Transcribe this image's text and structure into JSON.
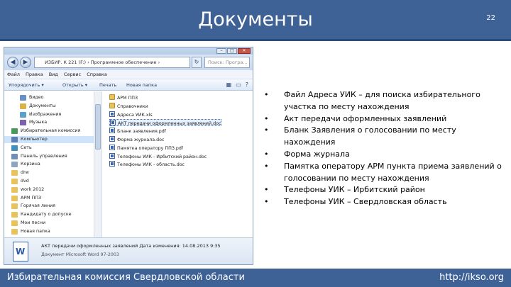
{
  "slide": {
    "title": "Документы",
    "number": "22",
    "footer_left": "Избирательная комиссия Свердловской области",
    "footer_right": "http://ikso.org",
    "header_color": "#3f6296"
  },
  "explorer": {
    "address": "ИЗБИР. К 221 (F:) › Программное обеспечение ›",
    "search_placeholder": "Поиск: Програ...",
    "menu": [
      "Файл",
      "Правка",
      "Вид",
      "Сервис",
      "Справка"
    ],
    "toolbar": {
      "organize": "Упорядочить ▾",
      "open": "Открыть ▾",
      "print": "Печать",
      "new_folder": "Новая папка"
    },
    "nav_items": [
      {
        "label": "Видео",
        "icon": "video-icon"
      },
      {
        "label": "Документы",
        "icon": "documents-icon"
      },
      {
        "label": "Изображения",
        "icon": "pictures-icon"
      },
      {
        "label": "Музыка",
        "icon": "music-icon"
      },
      {
        "label": "Избирательная комиссия",
        "icon": "homegroup-icon"
      },
      {
        "label": "Компьютер",
        "icon": "computer-icon",
        "selected": true
      },
      {
        "label": "Сеть",
        "icon": "network-icon"
      },
      {
        "label": "Панель управления",
        "icon": "control-panel-icon"
      },
      {
        "label": "Корзина",
        "icon": "recycle-bin-icon"
      },
      {
        "label": "drw",
        "icon": "folder-icon"
      },
      {
        "label": "dvd",
        "icon": "folder-icon"
      },
      {
        "label": "work 2012",
        "icon": "folder-icon"
      },
      {
        "label": "АРМ ППЗ",
        "icon": "folder-icon"
      },
      {
        "label": "Горячая линия",
        "icon": "folder-icon"
      },
      {
        "label": "Кандидату о допуске",
        "icon": "folder-icon"
      },
      {
        "label": "Мои песни",
        "icon": "folder-icon"
      },
      {
        "label": "Новая папка",
        "icon": "folder-icon"
      }
    ],
    "files": [
      {
        "label": "АРМ ППЗ",
        "kind": "folder"
      },
      {
        "label": "Справочники",
        "kind": "folder"
      },
      {
        "label": "Адреса УИК.xls",
        "kind": "doc"
      },
      {
        "label": "АКТ передачи оформленных заявлений.doc",
        "kind": "doc",
        "selected": true
      },
      {
        "label": "Бланк заявления.pdf",
        "kind": "doc"
      },
      {
        "label": "Форма журнала.doc",
        "kind": "doc"
      },
      {
        "label": "Памятка оператору ППЗ.pdf",
        "kind": "doc"
      },
      {
        "label": "Телефоны УИК - Ирбитский район.doc",
        "kind": "doc"
      },
      {
        "label": "Телефоны УИК - область.doc",
        "kind": "doc"
      }
    ],
    "details": {
      "name": "АКТ передачи оформленных заявлений   Дата изменения: 14.08.2013 9:35",
      "type": "Документ Microsoft Word 97-2003"
    }
  },
  "bullets": [
    "Файл Адреса УИК – для поиска избирательного участка по месту нахождения",
    "Акт передачи оформленных заявлений",
    "Бланк Заявления о голосовании по месту нахождения",
    "Форма журнала",
    "Памятка оператору АРМ пункта приема заявлений о голосовании по месту нахождения",
    "Телефоны УИК – Ирбитский район",
    "Телефоны УИК – Свердловская область"
  ]
}
